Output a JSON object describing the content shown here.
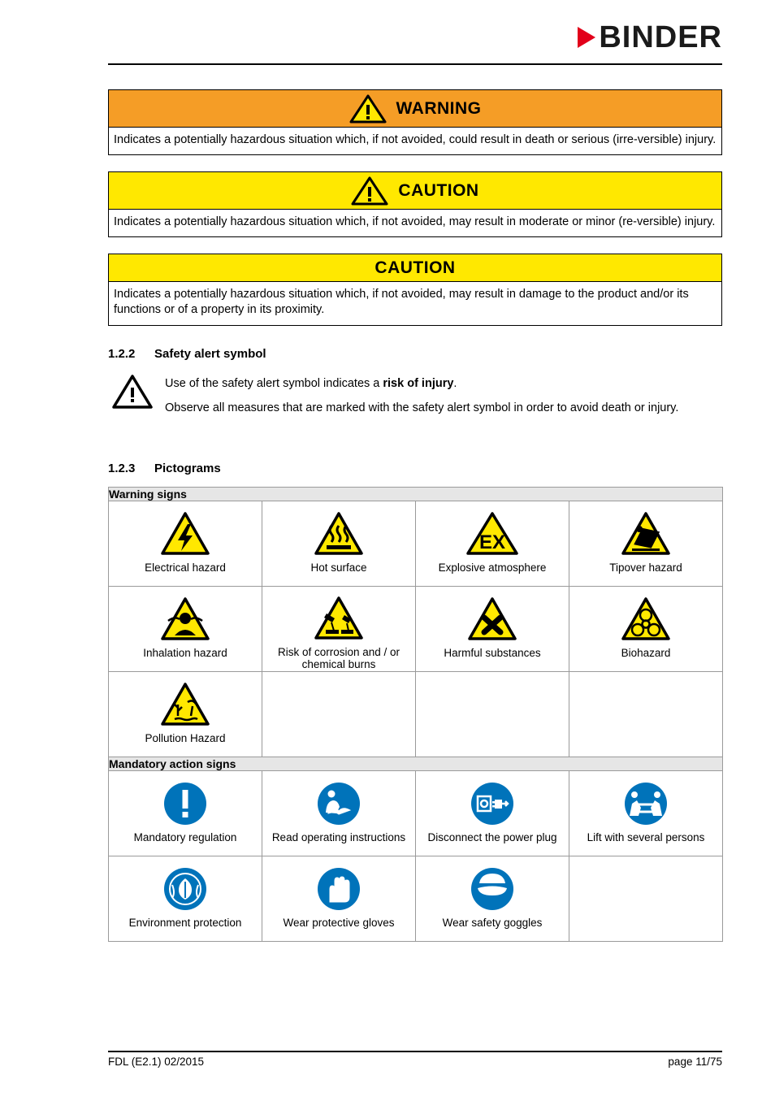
{
  "header": {
    "logo_text": "BINDER",
    "logo_mark": "red-triangle-icon"
  },
  "notices": [
    {
      "id": "warning",
      "title": "WARNING",
      "icon": "warning-triangle-icon",
      "has_icon": true,
      "bg": "#f59d26",
      "body": "Indicates a potentially hazardous situation which, if not avoided, could result in death or serious (irre-versible) injury."
    },
    {
      "id": "caution",
      "title": "CAUTION",
      "icon": "warning-triangle-icon",
      "has_icon": true,
      "bg": "#ffe800",
      "body": "Indicates a potentially hazardous situation which, if not avoided, may result in moderate or minor (re-versible) injury."
    },
    {
      "id": "caution-product",
      "title": "CAUTION",
      "icon": "",
      "has_icon": false,
      "bg": "#ffe800",
      "body": "Indicates a potentially hazardous situation which, if not avoided, may result in damage to the product and/or its functions or of a property in its proximity."
    }
  ],
  "sections": {
    "safety_alert": {
      "number": "1.2.2",
      "title": "Safety alert symbol",
      "icon": "safety-alert-triangle-icon",
      "paragraph1_prefix": "Use of the safety alert symbol indicates a ",
      "paragraph1_bold": "risk of injury",
      "paragraph1_suffix": ".",
      "paragraph2": "Observe all measures that are marked with the safety alert symbol in order to avoid death or injury."
    },
    "pictograms": {
      "number": "1.2.3",
      "title": "Pictograms"
    }
  },
  "table": {
    "warning_signs_header": "Warning signs",
    "mandatory_header": "Mandatory action signs",
    "warning_rows": [
      [
        {
          "icon": "electrical-hazard-icon",
          "label": "Electrical hazard"
        },
        {
          "icon": "hot-surface-icon",
          "label": "Hot surface"
        },
        {
          "icon": "explosive-atmosphere-icon",
          "label": "Explosive atmosphere"
        },
        {
          "icon": "tipover-hazard-icon",
          "label": "Tipover hazard"
        }
      ],
      [
        {
          "icon": "inhalation-hazard-icon",
          "label": "Inhalation hazard"
        },
        {
          "icon": "corrosion-hazard-icon",
          "label": "Risk of corrosion and / or chemical burns"
        },
        {
          "icon": "harmful-substances-icon",
          "label": "Harmful substances"
        },
        {
          "icon": "biohazard-icon",
          "label": "Biohazard"
        }
      ],
      [
        {
          "icon": "pollution-hazard-icon",
          "label": "Pollution Hazard"
        },
        {
          "icon": "",
          "label": ""
        },
        {
          "icon": "",
          "label": ""
        },
        {
          "icon": "",
          "label": ""
        }
      ]
    ],
    "mandatory_rows": [
      [
        {
          "icon": "mandatory-regulation-icon",
          "label": "Mandatory regulation"
        },
        {
          "icon": "read-operating-instructions-icon",
          "label": "Read operating instructions"
        },
        {
          "icon": "disconnect-power-plug-icon",
          "label": "Disconnect the power plug"
        },
        {
          "icon": "lift-with-several-persons-icon",
          "label": "Lift with several persons"
        }
      ],
      [
        {
          "icon": "environment-protection-icon",
          "label": "Environment protection"
        },
        {
          "icon": "wear-protective-gloves-icon",
          "label": "Wear protective gloves"
        },
        {
          "icon": "wear-safety-goggles-icon",
          "label": "Wear safety goggles"
        },
        {
          "icon": "",
          "label": ""
        }
      ]
    ]
  },
  "footer": {
    "left": "FDL (E2.1) 02/2015",
    "right": "page 11/75"
  },
  "colors": {
    "brand_red": "#e2001a",
    "warning_orange": "#f59d26",
    "caution_yellow": "#ffe800",
    "mandatory_blue": "#0073ba"
  }
}
